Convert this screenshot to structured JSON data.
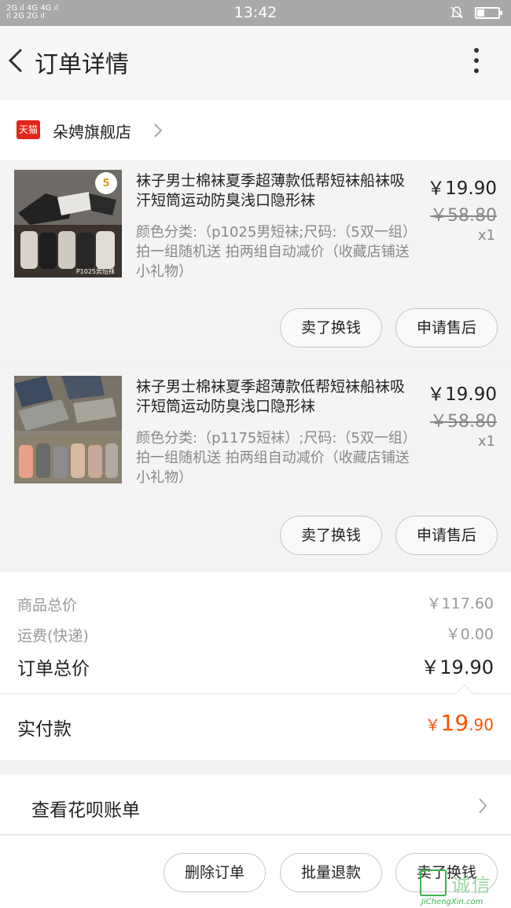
{
  "status_bar": {
    "signal_top": "2G ıl 4G 4G ıl",
    "signal_bottom": "ıl 2G 2G ıl",
    "time": "13:42"
  },
  "nav": {
    "title": "订单详情",
    "back_icon": "chevron-left-icon",
    "more_icon": "more-vertical-icon"
  },
  "shop": {
    "logo_text": "天猫",
    "name": "朵娉旗舰店"
  },
  "items": [
    {
      "title": "袜子男士棉袜夏季超薄款低帮短袜船袜吸汗短筒运动防臭浅口隐形袜",
      "spec": "颜色分类:（p1025男短袜;尺码:（5双一组）拍一组随机送 拍两组自动减价（收藏店铺送小礼物）",
      "price": "￥19.90",
      "old_price": "￥58.80",
      "qty": "x1",
      "thumb_badge": "5",
      "thumb_caption": "P1025男短袜",
      "btn_sell": "卖了换钱",
      "btn_after_sale": "申请售后"
    },
    {
      "title": "袜子男士棉袜夏季超薄款低帮短袜船袜吸汗短筒运动防臭浅口隐形袜",
      "spec": "颜色分类:（p1175短袜）;尺码:（5双一组）拍一组随机送 拍两组自动减价（收藏店铺送小礼物）",
      "price": "￥19.90",
      "old_price": "￥58.80",
      "qty": "x1",
      "btn_sell": "卖了换钱",
      "btn_after_sale": "申请售后"
    }
  ],
  "summary": {
    "goods_total_label": "商品总价",
    "goods_total": "￥117.60",
    "shipping_label": "运费(快递)",
    "shipping": "￥0.00",
    "order_total_label": "订单总价",
    "order_total": "￥19.90",
    "paid_label": "实付款",
    "paid_currency": "￥",
    "paid_int": "19",
    "paid_dec": ".90",
    "paid_color": "#ff5000"
  },
  "huabei": {
    "label": "查看花呗账单"
  },
  "bottom_actions": {
    "delete": "删除订单",
    "bulk_refund": "批量退款",
    "sell": "卖了换钱"
  },
  "watermark": {
    "text": "诚信",
    "sub": "JiChengXin.com"
  }
}
